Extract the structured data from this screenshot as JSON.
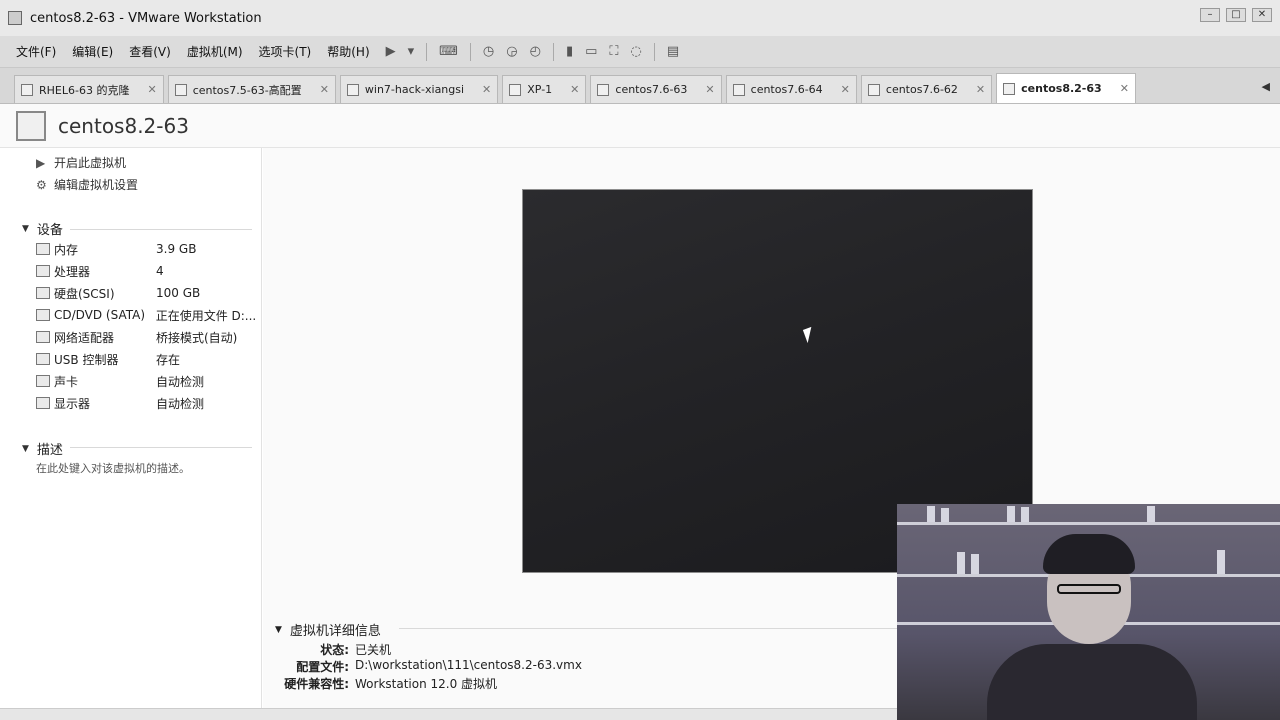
{
  "window": {
    "title": "centos8.2-63 - VMware Workstation"
  },
  "menu": [
    {
      "label": "文件(F)"
    },
    {
      "label": "编辑(E)"
    },
    {
      "label": "查看(V)"
    },
    {
      "label": "虚拟机(M)"
    },
    {
      "label": "选项卡(T)"
    },
    {
      "label": "帮助(H)"
    }
  ],
  "tabs": [
    {
      "label": "RHEL6-63 的克隆",
      "active": false
    },
    {
      "label": "centos7.5-63-高配置",
      "active": false
    },
    {
      "label": "win7-hack-xiangsi",
      "active": false
    },
    {
      "label": "XP-1",
      "active": false
    },
    {
      "label": "centos7.6-63",
      "active": false
    },
    {
      "label": "centos7.6-64",
      "active": false
    },
    {
      "label": "centos7.6-62",
      "active": false
    },
    {
      "label": "centos8.2-63",
      "active": true
    }
  ],
  "vm": {
    "name": "centos8.2-63"
  },
  "actions": {
    "power_on": "开启此虚拟机",
    "edit_settings": "编辑虚拟机设置"
  },
  "devices": {
    "title": "设备",
    "items": [
      {
        "name": "内存",
        "value": "3.9 GB",
        "icon": "memory-icon"
      },
      {
        "name": "处理器",
        "value": "4",
        "icon": "cpu-icon"
      },
      {
        "name": "硬盘(SCSI)",
        "value": "100 GB",
        "icon": "disk-icon"
      },
      {
        "name": "CD/DVD (SATA)",
        "value": "正在使用文件 D:...",
        "icon": "cd-icon"
      },
      {
        "name": "网络适配器",
        "value": "桥接模式(自动)",
        "icon": "network-icon"
      },
      {
        "name": "USB 控制器",
        "value": "存在",
        "icon": "usb-icon"
      },
      {
        "name": "声卡",
        "value": "自动检测",
        "icon": "sound-icon"
      },
      {
        "name": "显示器",
        "value": "自动检测",
        "icon": "display-icon"
      }
    ]
  },
  "description": {
    "title": "描述",
    "placeholder": "在此处键入对该虚拟机的描述。"
  },
  "details": {
    "title": "虚拟机详细信息",
    "status_label": "状态:",
    "status_value": "已关机",
    "config_label": "配置文件:",
    "config_value": "D:\\workstation\\111\\centos8.2-63.vmx",
    "compat_label": "硬件兼容性:",
    "compat_value": "Workstation 12.0 虚拟机"
  }
}
